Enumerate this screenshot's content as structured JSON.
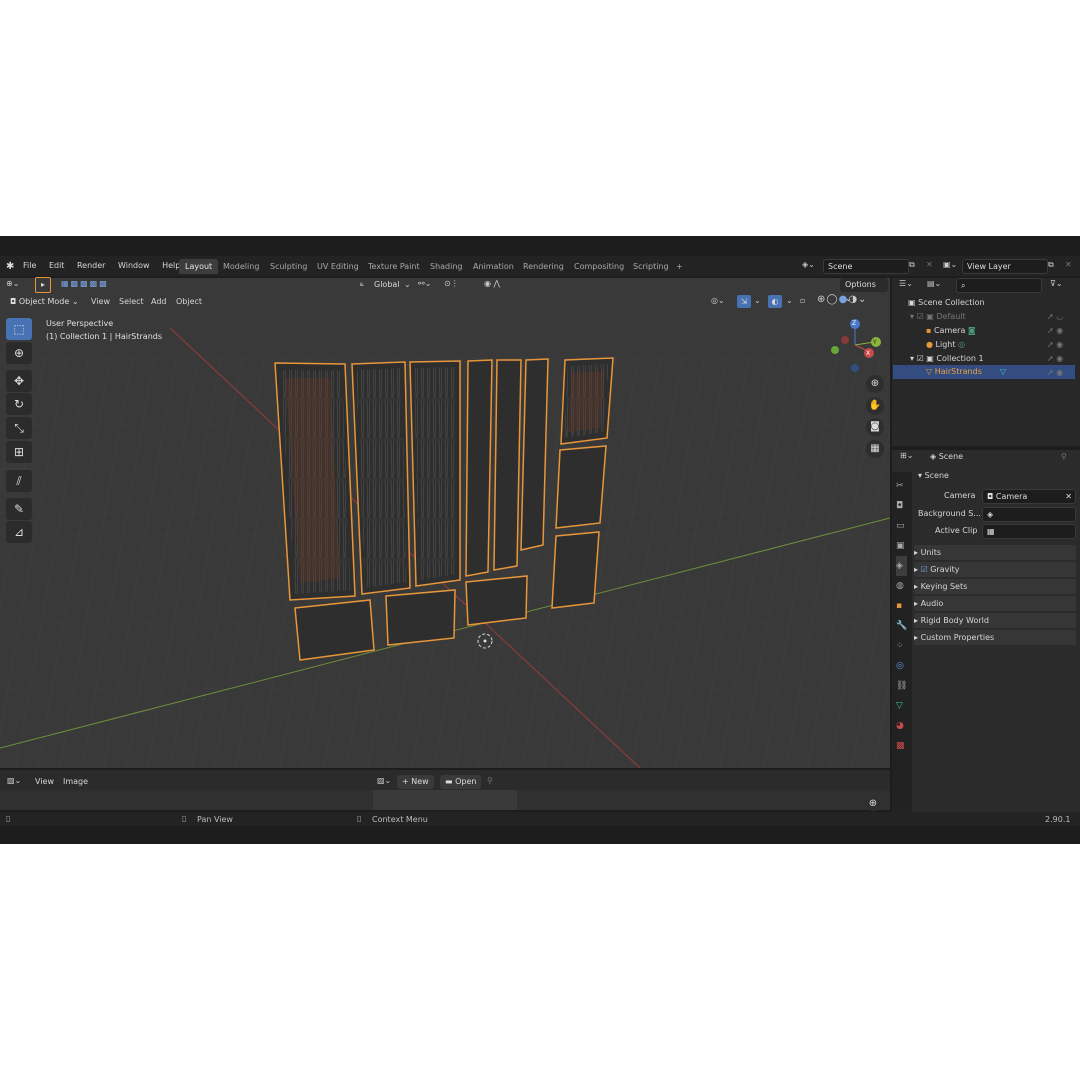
{
  "menu": [
    "File",
    "Edit",
    "Render",
    "Window",
    "Help"
  ],
  "workspaces": [
    "Layout",
    "Modeling",
    "Sculpting",
    "UV Editing",
    "Texture Paint",
    "Shading",
    "Animation",
    "Rendering",
    "Compositing",
    "Scripting"
  ],
  "workspace_add": "+",
  "scene_field": "Scene",
  "view_layer_field": "View Layer",
  "header": {
    "mode": "Object Mode",
    "view": "View",
    "select": "Select",
    "add": "Add",
    "object": "Object",
    "transform": "Global",
    "options": "Options"
  },
  "viewport": {
    "perspective": "User Perspective",
    "collection_info": "(1) Collection 1 | HairStrands",
    "axes": {
      "x": "X",
      "y": "Y",
      "z": "Z"
    }
  },
  "outliner": {
    "root": "Scene Collection",
    "items": [
      {
        "label": "Default",
        "level": 1
      },
      {
        "label": "Camera",
        "level": 2
      },
      {
        "label": "Light",
        "level": 2
      },
      {
        "label": "Collection 1",
        "level": 1
      },
      {
        "label": "HairStrands",
        "level": 2
      }
    ],
    "search_placeholder": ""
  },
  "properties": {
    "title": "Scene",
    "section": "Scene",
    "camera_label": "Camera",
    "camera_value": "Camera",
    "bg_label": "Background S...",
    "clip_label": "Active Clip",
    "panels": [
      "Units",
      "Gravity",
      "Keying Sets",
      "Audio",
      "Rigid Body World",
      "Custom Properties"
    ]
  },
  "image_editor": {
    "view": "View",
    "image": "Image",
    "new": "New",
    "open": "Open"
  },
  "status": {
    "pan": "Pan View",
    "context": "Context Menu",
    "version": "2.90.1"
  },
  "colors": {
    "accent": "#4772b3",
    "selection": "#f0a040",
    "active_row": "#334d80"
  }
}
